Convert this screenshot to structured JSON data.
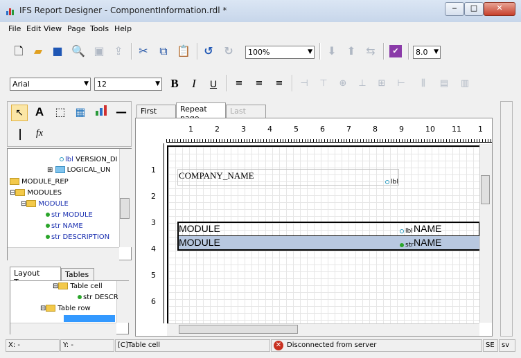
{
  "window": {
    "title": "IFS Report Designer - ComponentInformation.rdl *"
  },
  "menu": [
    "File",
    "Edit",
    "View",
    "Page",
    "Tools",
    "Help"
  ],
  "toolbar": {
    "zoom": "100%",
    "version": "8.0",
    "font_family": "Arial",
    "font_size": "12",
    "bold": "B",
    "italic": "I",
    "underline": "U"
  },
  "data_tree": {
    "items": [
      {
        "label": "VERSION_DI",
        "prefix": "lbl"
      },
      {
        "label": "LOGICAL_UN"
      },
      {
        "label": "MODULE_REP"
      },
      {
        "label": "MODULES"
      },
      {
        "label": "MODULE"
      },
      {
        "label": "MODULE",
        "prefix": "str"
      },
      {
        "label": "NAME",
        "prefix": "str"
      },
      {
        "label": "DESCRIPTION",
        "prefix": "str"
      }
    ]
  },
  "layout_tabs": [
    "Layout Tree",
    "Tables"
  ],
  "layout_tree": {
    "items": [
      {
        "label": "Table cell"
      },
      {
        "label": "DESCR",
        "prefix": "str"
      },
      {
        "label": "Table row"
      }
    ]
  },
  "page_tabs": [
    "First page",
    "Repeat page",
    "Last page"
  ],
  "ruler": {
    "h": [
      "1",
      "2",
      "3",
      "4",
      "5",
      "6",
      "7",
      "8",
      "9",
      "10",
      "11",
      "1"
    ],
    "v": [
      "1",
      "2",
      "3",
      "4",
      "5",
      "6"
    ]
  },
  "canvas": {
    "company": "COMPANY_NAME",
    "company_tag": "lbl",
    "header_left": "MODULE",
    "header_tag": "lbl",
    "header_right": "NAME",
    "row_left": "MODULE",
    "row_tag": "str",
    "row_right": "NAME"
  },
  "status": {
    "x": "X: -",
    "y": "Y: -",
    "selection": "[C]Table cell",
    "connection": "Disconnected from server",
    "se": "SE",
    "sv": "sv"
  },
  "colors": {
    "selected_row": "#b8c8e0",
    "accent": "#1a2fb0"
  }
}
